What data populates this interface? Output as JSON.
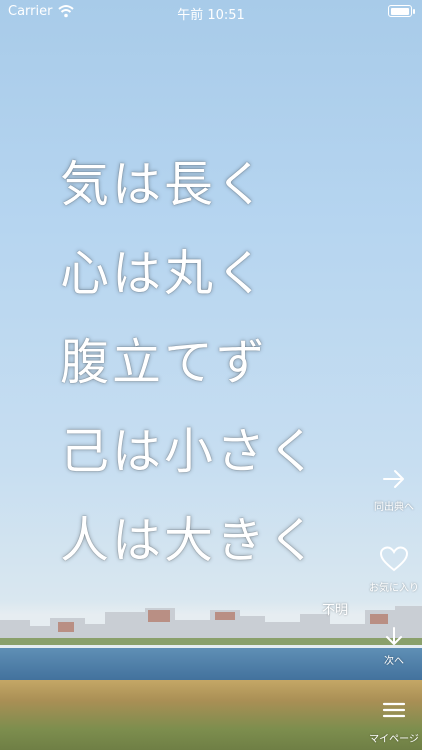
{
  "status": {
    "carrier": "Carrier",
    "time": "午前 10:51"
  },
  "quote": {
    "lines": [
      "気は長く",
      "心は丸く",
      "腹立てず",
      "己は小さく",
      "人は大きく"
    ],
    "author": "不明"
  },
  "actions": {
    "same_source": "同出典へ",
    "favorite": "お気に入り",
    "next": "次へ",
    "mypage": "マイページ"
  }
}
